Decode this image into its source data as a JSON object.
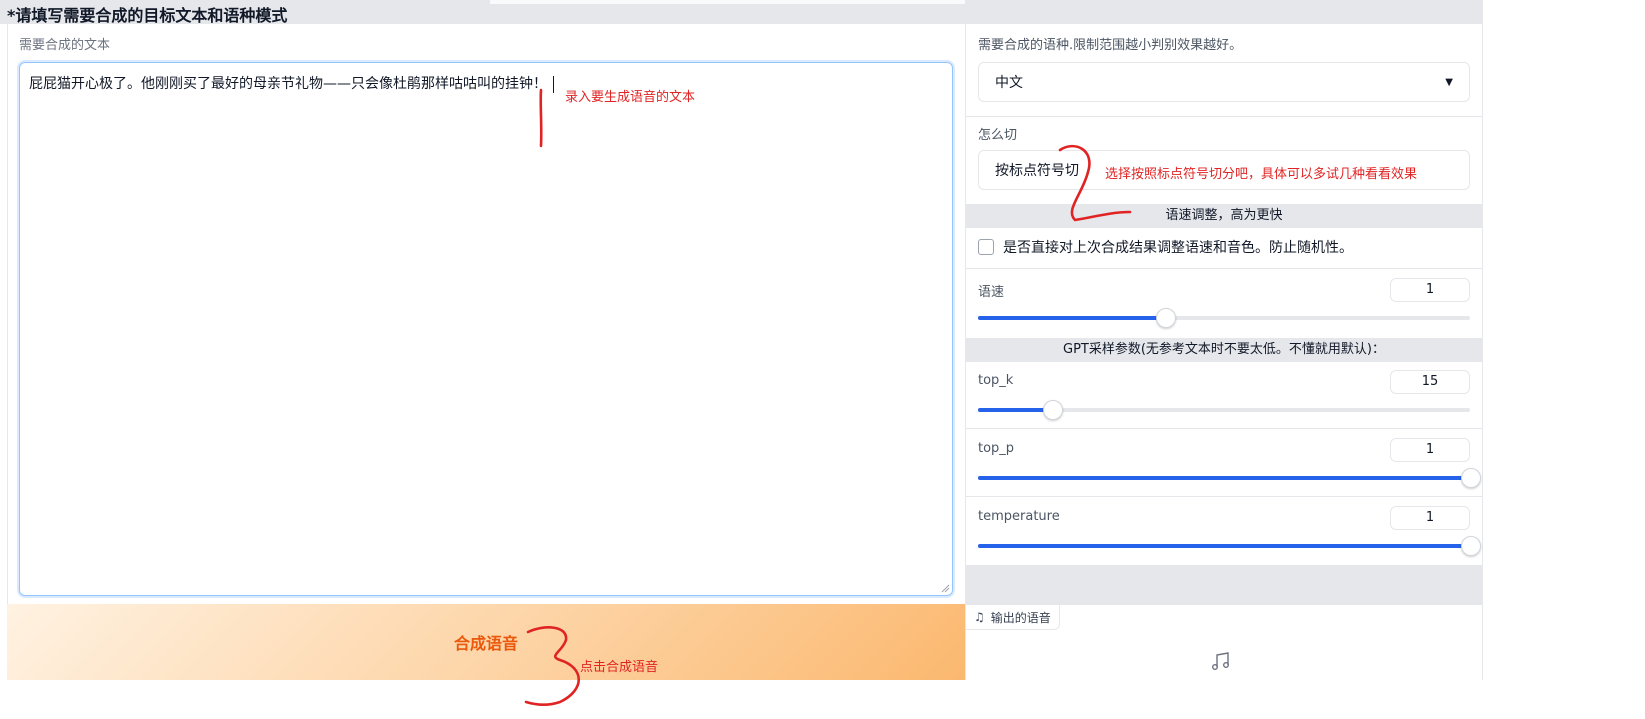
{
  "header": {
    "title": "*请填写需要合成的目标文本和语种模式"
  },
  "left": {
    "label": "需要合成的文本",
    "text_value": "屁屁猫开心极了。他刚刚买了最好的母亲节礼物——只会像杜鹃那样咕咕叫的挂钟！"
  },
  "right": {
    "language_label": "需要合成的语种.限制范围越小判别效果越好。",
    "language_value": "中文",
    "cut_label": "怎么切",
    "cut_value": "按标点符号切",
    "speed_section": "语速调整，高为更快",
    "checkbox_label": "是否直接对上次合成结果调整语速和音色。防止随机性。",
    "checkbox_checked": false,
    "speed": {
      "label": "语速",
      "value": "1",
      "fraction": 0.38
    },
    "gpt_section": "GPT采样参数(无参考文本时不要太低。不懂就用默认)：",
    "top_k": {
      "label": "top_k",
      "value": "15",
      "fraction": 0.15
    },
    "top_p": {
      "label": "top_p",
      "value": "1",
      "fraction": 1.0
    },
    "temperature": {
      "label": "temperature",
      "value": "1",
      "fraction": 1.0
    }
  },
  "generate_button": {
    "label": "合成语音"
  },
  "output": {
    "label": "输出的语音"
  },
  "annotations": {
    "a1": "录入要生成语音的文本",
    "a2": "选择按照标点符号切分吧，具体可以多试几种看看效果",
    "a3": "点击合成语音"
  },
  "colors": {
    "accent": "#2563eb",
    "annotation": "#e02424",
    "button_text": "#ea580c"
  }
}
